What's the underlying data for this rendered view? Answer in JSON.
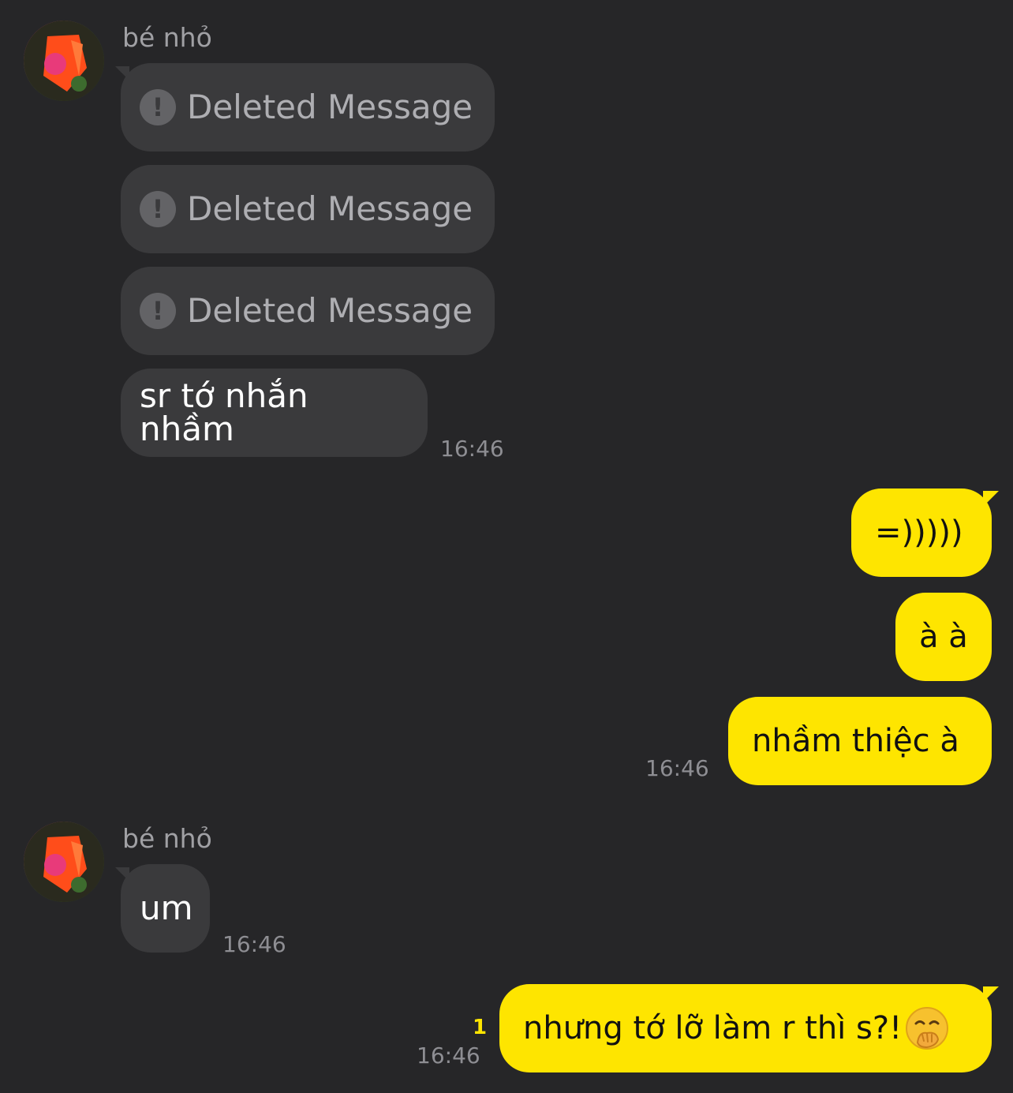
{
  "contact": {
    "name": "bé nhỏ",
    "avatar_icon": "avatar-photo"
  },
  "messages": {
    "in1": {
      "deleted_label_1": "Deleted Message",
      "deleted_label_2": "Deleted Message",
      "deleted_label_3": "Deleted Message",
      "text": "sr tớ nhắn nhầm",
      "time": "16:46"
    },
    "out1": {
      "msg1": "=)))))",
      "msg2": "à à",
      "msg3": "nhầm thiệc à",
      "time": "16:46"
    },
    "in2": {
      "text": "um",
      "time": "16:46"
    },
    "out2": {
      "text": "nhưng tớ lỡ làm r thì s?!",
      "emoji_icon": "face-with-hand-over-mouth-icon",
      "time": "16:46",
      "unread_count": "1"
    }
  },
  "colors": {
    "background": "#262628",
    "incoming_bubble": "#3a3a3c",
    "outgoing_bubble": "#fee500"
  }
}
